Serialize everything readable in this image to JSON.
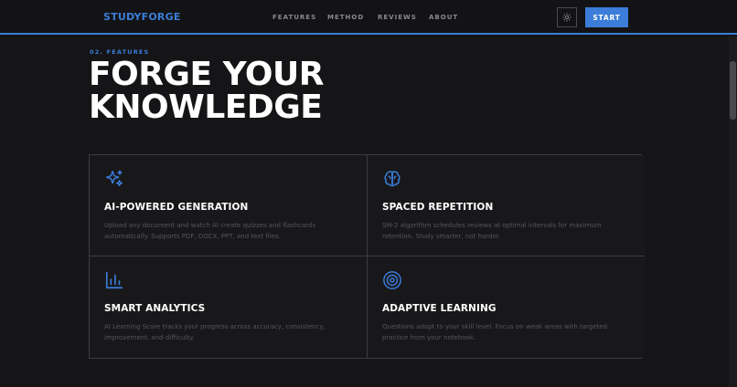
{
  "nav": {
    "logo": "STUDYFORGE",
    "links": [
      "FEATURES",
      "METHOD",
      "REVIEWS",
      "ABOUT"
    ],
    "theme_icon": "sun-icon",
    "start_label": "START"
  },
  "section": {
    "eyebrow": "02. FEATURES",
    "headline_line1": "FORGE YOUR",
    "headline_line2": "KNOWLEDGE"
  },
  "features": [
    {
      "icon": "sparkles-icon",
      "title": "AI-POWERED GENERATION",
      "description": "Upload any document and watch AI create quizzes and flashcards automatically. Supports PDF, DOCX, PPT, and text files."
    },
    {
      "icon": "brain-icon",
      "title": "SPACED REPETITION",
      "description": "SM-2 algorithm schedules reviews at optimal intervals for maximum retention. Study smarter, not harder."
    },
    {
      "icon": "bar-chart-icon",
      "title": "SMART ANALYTICS",
      "description": "AI Learning Score tracks your progress across accuracy, consistency, improvement, and difficulty."
    },
    {
      "icon": "target-icon",
      "title": "ADAPTIVE LEARNING",
      "description": "Questions adapt to your skill level. Focus on weak areas with targeted practice from your notebook."
    }
  ],
  "colors": {
    "accent": "#3b7dd8",
    "background": "#151517",
    "card_border": "#3a3d46"
  }
}
